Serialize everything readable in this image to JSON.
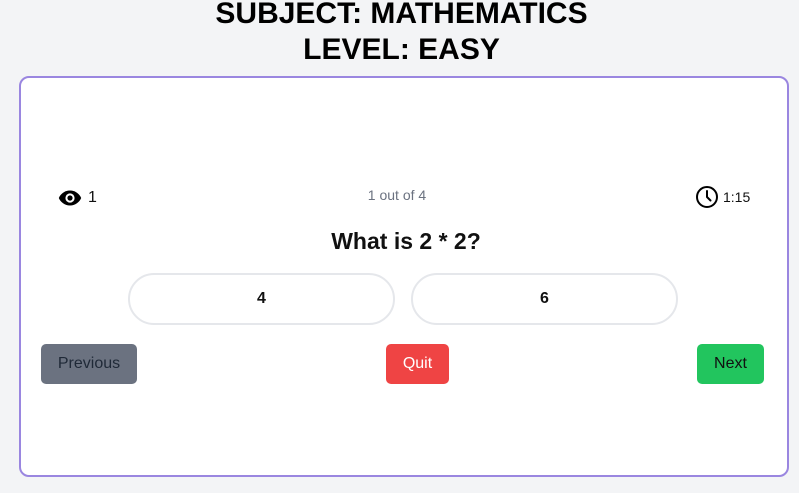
{
  "header": {
    "subject_line": "SUBJECT: MATHEMATICS",
    "level_line": "LEVEL: EASY"
  },
  "quiz": {
    "views_count": "1",
    "progress_text": "1 out of 4",
    "timer_text": "1:15",
    "question": "What is 2 * 2?",
    "answers": [
      "4",
      "6"
    ]
  },
  "controls": {
    "previous_label": "Previous",
    "quit_label": "Quit",
    "next_label": "Next"
  },
  "colors": {
    "card_border": "#9a86e0",
    "previous_bg": "#6b7280",
    "quit_bg": "#ef4444",
    "next_bg": "#22c55e"
  },
  "icons": {
    "views": "eye-icon",
    "timer": "clock-icon"
  }
}
